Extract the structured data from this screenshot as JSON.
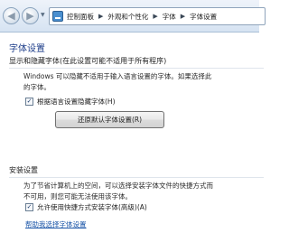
{
  "nav": {
    "back_glyph": "◀",
    "forward_glyph": "▶",
    "history_glyph": "▼",
    "address_icon": "control-panel-icon",
    "breadcrumbs": [
      "控制面板",
      "外观和个性化",
      "字体",
      "字体设置"
    ],
    "separator": "▶"
  },
  "page": {
    "title": "字体设置"
  },
  "section_hide_fonts": {
    "heading": "显示和隐藏字体(在此设置可能不适用于所有程序)",
    "description": [
      "Windows 可以隐藏不适用于输入语言设置的字体。如果选择此",
      "的字体。"
    ],
    "checkbox_label": "根据语言设置隐藏字体(H)",
    "checkbox_checked": true,
    "check_glyph": "✓",
    "restore_button": "还原默认字体设置(R)"
  },
  "section_install": {
    "heading": "安装设置",
    "description": [
      "为了节省计算机上的空间，可以选择安装字体文件的快捷方式而",
      "不可用，则您可能无法使用该字体。"
    ],
    "checkbox_label": "允许使用快捷方式安装字体(高级)(A)",
    "checkbox_checked": true,
    "check_glyph": "✓"
  },
  "help_link": "帮助我选择字体设置",
  "colors": {
    "title": "#1e3e8a",
    "link": "#1a55a8",
    "navbar": "#d6e3f2"
  }
}
